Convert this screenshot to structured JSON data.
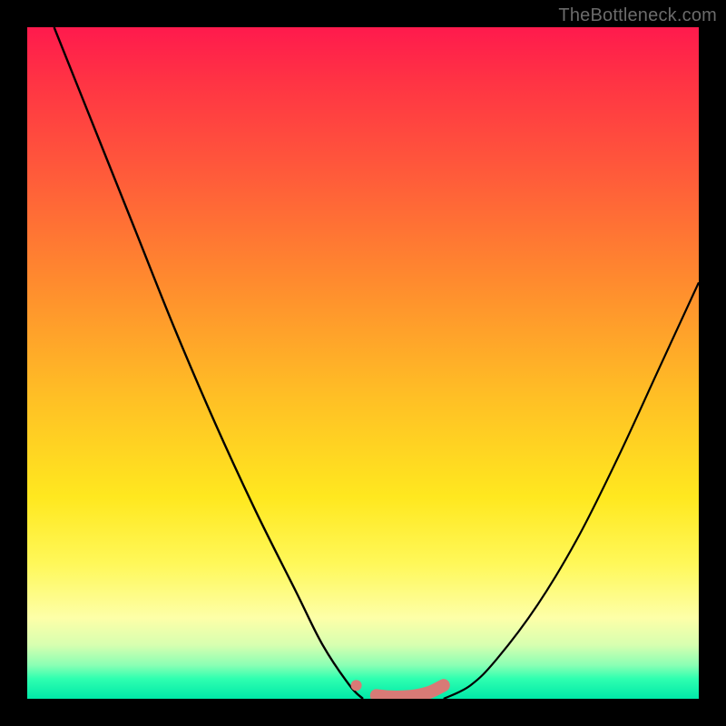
{
  "watermark": "TheBottleneck.com",
  "colors": {
    "frame": "#000000",
    "curve_stroke": "#000000",
    "marker_fill": "#d87a76",
    "gradient_stops": [
      "#ff1a4d",
      "#ff3344",
      "#ff5b3a",
      "#ff8b2e",
      "#ffbf25",
      "#ffe81f",
      "#fff85a",
      "#fdffa8",
      "#d7ffb0",
      "#8affb4",
      "#2fffb0",
      "#00e9a8"
    ]
  },
  "chart_data": {
    "type": "line",
    "title": "",
    "xlabel": "",
    "ylabel": "",
    "xlim": [
      0,
      100
    ],
    "ylim": [
      0,
      100
    ],
    "grid": false,
    "series": [
      {
        "name": "left-curve",
        "x": [
          4,
          10,
          16,
          22,
          28,
          34,
          40,
          44,
          48,
          50
        ],
        "values": [
          100,
          85,
          70,
          55,
          41,
          28,
          16,
          8,
          2,
          0
        ]
      },
      {
        "name": "right-curve",
        "x": [
          62,
          66,
          70,
          76,
          82,
          88,
          94,
          100
        ],
        "values": [
          0,
          2,
          6,
          14,
          24,
          36,
          49,
          62
        ]
      },
      {
        "name": "bottom-markers",
        "x": [
          49,
          52,
          54,
          56,
          58,
          60,
          62
        ],
        "values": [
          2,
          0.5,
          0.3,
          0.3,
          0.5,
          1,
          2
        ]
      }
    ],
    "annotations": [
      {
        "text": "TheBottleneck.com",
        "role": "watermark",
        "position": "top-right"
      }
    ]
  }
}
